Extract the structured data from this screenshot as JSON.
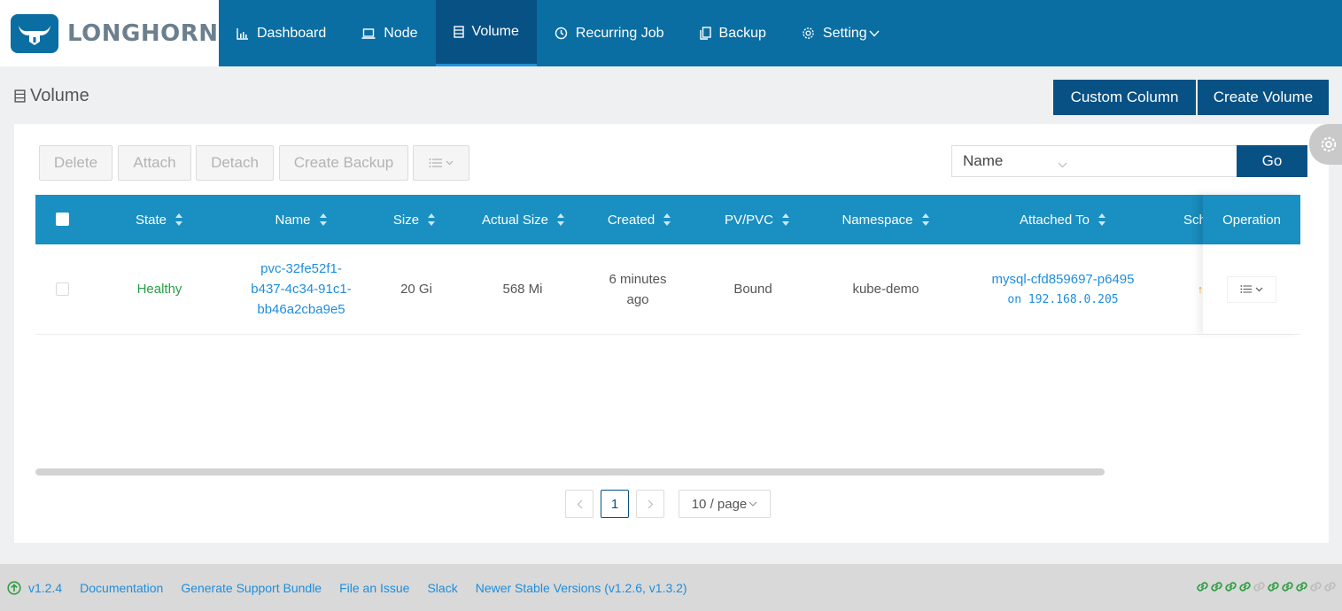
{
  "app": {
    "logo_text": "LONGHORN"
  },
  "nav": [
    {
      "label": "Dashboard",
      "icon": "bar-chart-icon"
    },
    {
      "label": "Node",
      "icon": "laptop-icon"
    },
    {
      "label": "Volume",
      "icon": "database-icon",
      "active": true
    },
    {
      "label": "Recurring Job",
      "icon": "clock-icon"
    },
    {
      "label": "Backup",
      "icon": "copy-icon"
    },
    {
      "label": "Setting",
      "icon": "gear-icon"
    }
  ],
  "page": {
    "title": "Volume",
    "custom_column": "Custom Column",
    "create_volume": "Create Volume"
  },
  "toolbar": {
    "delete": "Delete",
    "attach": "Attach",
    "detach": "Detach",
    "create_backup": "Create Backup"
  },
  "search": {
    "field": "Name",
    "value": "",
    "go": "Go"
  },
  "table": {
    "headers": [
      "State",
      "Name",
      "Size",
      "Actual Size",
      "Created",
      "PV/PVC",
      "Namespace",
      "Attached To",
      "Sch",
      "Operation"
    ],
    "rows": [
      {
        "state": "Healthy",
        "name_line1": "pvc-32fe52f1-",
        "name_line2": "b437-4c34-91c1-",
        "name_line3": "bb46a2cba9e5",
        "size": "20 Gi",
        "actual_size": "568 Mi",
        "created_line1": "6 minutes",
        "created_line2": "ago",
        "pvpvc": "Bound",
        "namespace": "kube-demo",
        "attached_pod": "mysql-cfd859697-p6495",
        "attached_node": "on 192.168.0.205"
      }
    ]
  },
  "pagination": {
    "current": "1",
    "page_size": "10 / page"
  },
  "footer": {
    "version": "v1.2.4",
    "documentation": "Documentation",
    "support_bundle": "Generate Support Bundle",
    "file_issue": "File an Issue",
    "slack": "Slack",
    "newer_versions": "Newer Stable Versions (v1.2.6, v1.3.2)"
  },
  "colors": {
    "primary": "#0a6ea3",
    "dark": "#075184",
    "header": "#1a8fc1",
    "healthy": "#27a046",
    "link": "#1f8ddc",
    "link_ok": "#2f9e44",
    "link_off": "#bdbdbd"
  }
}
